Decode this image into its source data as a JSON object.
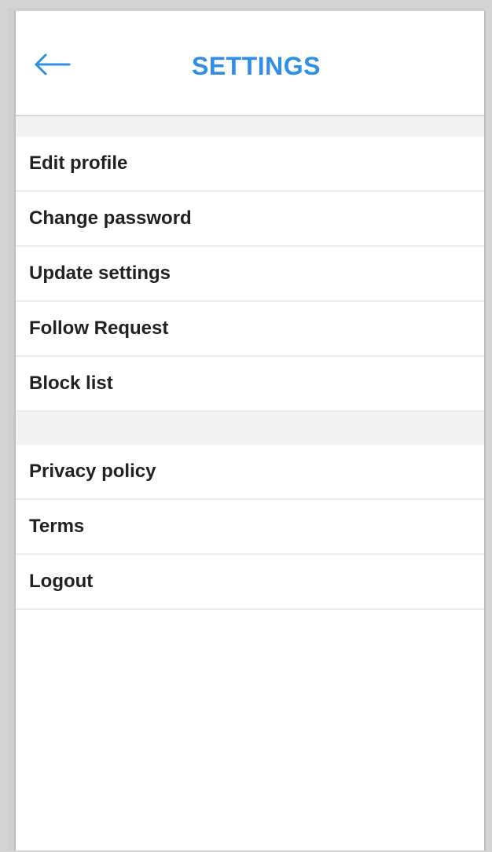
{
  "header": {
    "title": "SETTINGS",
    "back_icon": "arrow-left-icon",
    "accent_color": "#2f8fe6"
  },
  "groups": [
    {
      "items": [
        {
          "label": "Edit profile"
        },
        {
          "label": "Change password"
        },
        {
          "label": "Update settings"
        },
        {
          "label": "Follow Request"
        },
        {
          "label": "Block list"
        }
      ]
    },
    {
      "items": [
        {
          "label": "Privacy policy"
        },
        {
          "label": "Terms"
        },
        {
          "label": "Logout"
        }
      ]
    }
  ]
}
